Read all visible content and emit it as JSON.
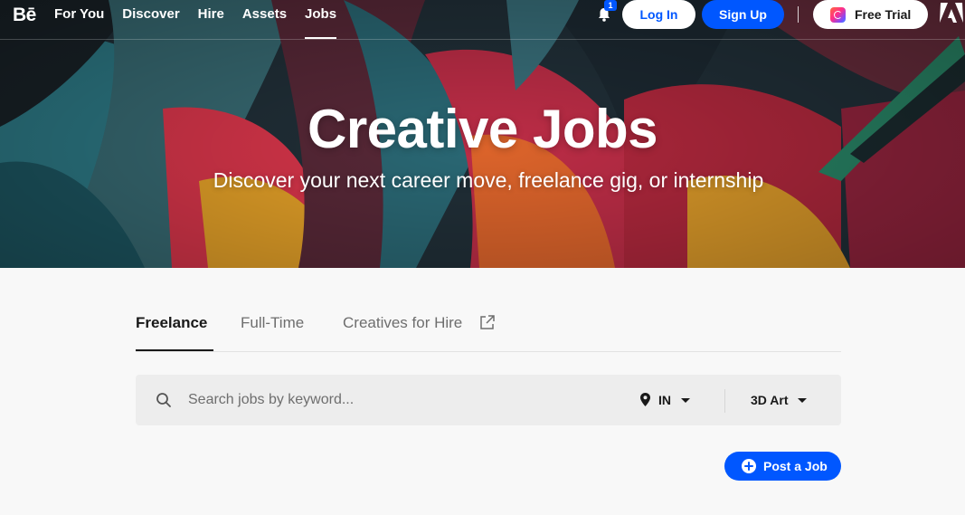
{
  "nav": {
    "logo": "Bē",
    "links": [
      {
        "label": "For You"
      },
      {
        "label": "Discover"
      },
      {
        "label": "Hire"
      },
      {
        "label": "Assets"
      },
      {
        "label": "Jobs",
        "active": true
      }
    ],
    "notification_count": "1",
    "login_label": "Log In",
    "signup_label": "Sign Up",
    "trial_label": "Free Trial"
  },
  "hero": {
    "title": "Creative Jobs",
    "subtitle": "Discover your next career move, freelance gig, or internship"
  },
  "tabs": [
    {
      "label": "Freelance",
      "active": true
    },
    {
      "label": "Full-Time"
    },
    {
      "label": "Creatives for Hire",
      "icon": "external-link-icon"
    }
  ],
  "search": {
    "placeholder": "Search jobs by keyword...",
    "location": "IN",
    "category": "3D Art"
  },
  "post_job_label": "Post a Job",
  "colors": {
    "accent": "#0057ff",
    "text": "#191919",
    "muted": "#6e6e6e",
    "page_bg": "#f8f8f8",
    "search_bg": "#ededed"
  }
}
